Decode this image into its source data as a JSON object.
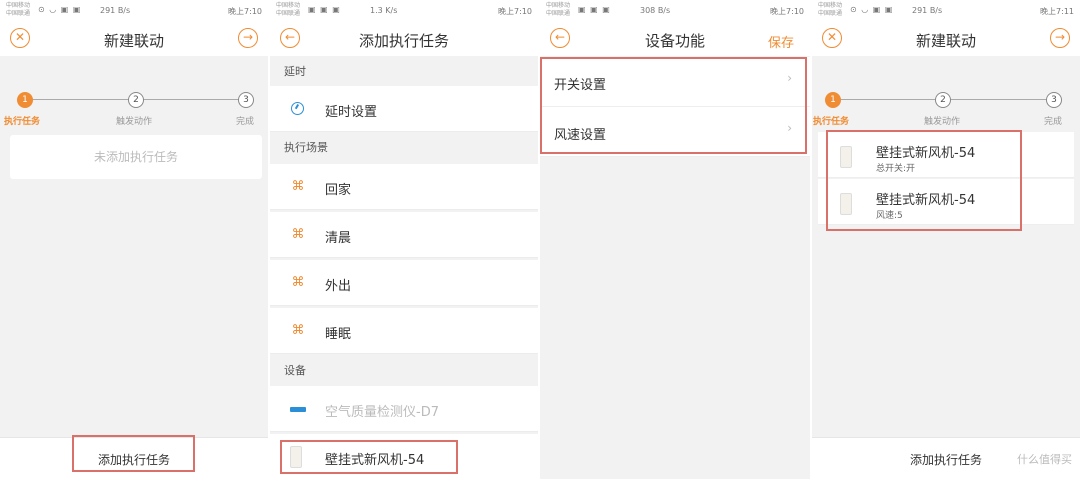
{
  "status": {
    "carrier1": "中国移动",
    "carrier2": "中国联通",
    "p1_speed": "291 B/s",
    "p1_time": "晚上7:10",
    "p2_speed": "1.3 K/s",
    "p2_time": "晚上7:10",
    "p3_speed": "308 B/s",
    "p3_time": "晚上7:10",
    "p4_speed": "291 B/s",
    "p4_time": "晚上7:11"
  },
  "panel1": {
    "title": "新建联动",
    "close_icon": "close-icon",
    "next_icon": "arrow-right-icon",
    "steps": [
      {
        "num": "1",
        "label": "执行任务"
      },
      {
        "num": "2",
        "label": "触发动作"
      },
      {
        "num": "3",
        "label": "完成"
      }
    ],
    "empty_text": "未添加执行任务",
    "add_button": "添加执行任务"
  },
  "panel2": {
    "title": "添加执行任务",
    "back_icon": "arrow-left-icon",
    "section_delay": "延时",
    "delay_item": "延时设置",
    "section_scene": "执行场景",
    "scenes": [
      "回家",
      "清晨",
      "外出",
      "睡眠"
    ],
    "section_device": "设备",
    "devices": [
      "空气质量检测仪-D7",
      "壁挂式新风机-54"
    ]
  },
  "panel3": {
    "title": "设备功能",
    "save": "保存",
    "functions": [
      "开关设置",
      "风速设置"
    ]
  },
  "panel4": {
    "title": "新建联动",
    "steps": [
      {
        "num": "1",
        "label": "执行任务"
      },
      {
        "num": "2",
        "label": "触发动作"
      },
      {
        "num": "3",
        "label": "完成"
      }
    ],
    "tasks": [
      {
        "name": "壁挂式新风机-54",
        "detail": "总开关:开"
      },
      {
        "name": "壁挂式新风机-54",
        "detail": "风速:5"
      }
    ],
    "add_button": "添加执行任务",
    "watermark": "什么值得买"
  },
  "colors": {
    "accent": "#f08c33",
    "highlight": "#d9716a",
    "device_blue": "#2b8fd8"
  }
}
